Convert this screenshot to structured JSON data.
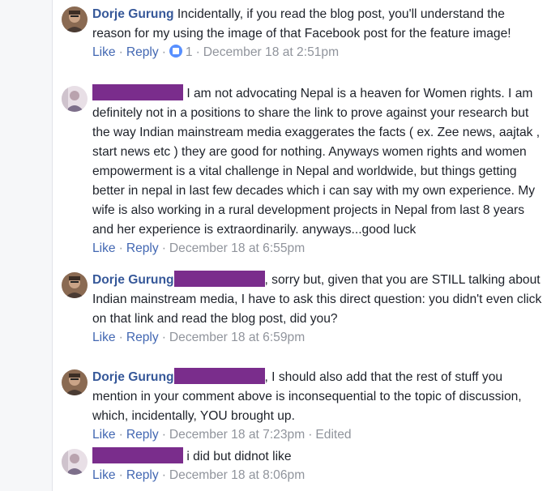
{
  "comments": [
    {
      "author": "Dorje Gurung",
      "avatar_icon": "user-avatar-photo",
      "text": " Incidentally, if you read the blog post, you'll understand the reason for my using the image of that Facebook post for the feature image!",
      "actions": {
        "like": "Like",
        "reply": "Reply",
        "reaction_count": "1",
        "timestamp": "December 18 at 2:51pm",
        "edited": ""
      }
    },
    {
      "author": "",
      "avatar_icon": "user-avatar-photo",
      "text": " I am not advocating Nepal is a heaven for Women rights. I am definitely not in a positions to share the link to prove against your research but the way Indian mainstream media exaggerates the facts ( ex. Zee news, aajtak , start news etc ) they are good for nothing. Anyways women rights and women empowerment is a vital challenge in Nepal and worldwide, but things getting better in nepal in last few decades which i can say with my own experience. My wife is also working in a rural development projects in Nepal from last 8 years and her experience is extraordinarily. anyways...good luck",
      "actions": {
        "like": "Like",
        "reply": "Reply",
        "timestamp": "December 18 at 6:55pm"
      }
    },
    {
      "author": "Dorje Gurung",
      "avatar_icon": "user-avatar-photo",
      "text": ", sorry but, given that you are STILL talking about Indian mainstream media, I have to ask this direct question: you didn't even click on that link and read the blog post, did you?",
      "actions": {
        "like": "Like",
        "reply": "Reply",
        "timestamp": "December 18 at 6:59pm"
      }
    },
    {
      "author": "Dorje Gurung",
      "avatar_icon": "user-avatar-photo",
      "text": ", I should also add that the rest of stuff you mention in your comment above is inconsequential to the topic of discussion, which, incidentally, YOU brought up.",
      "actions": {
        "like": "Like",
        "reply": "Reply",
        "timestamp": "December 18 at 7:23pm",
        "edited": "Edited"
      }
    },
    {
      "author": "",
      "avatar_icon": "user-avatar-photo",
      "text": " i did but didnot like",
      "actions": {
        "like": "Like",
        "reply": "Reply",
        "timestamp": "December 18 at 8:06pm"
      }
    }
  ],
  "colors": {
    "author_link": "#365899",
    "action_link": "#4267b2",
    "meta_gray": "#90949c",
    "redaction": "#7a2d8c",
    "like_badge": "#5890ff"
  }
}
